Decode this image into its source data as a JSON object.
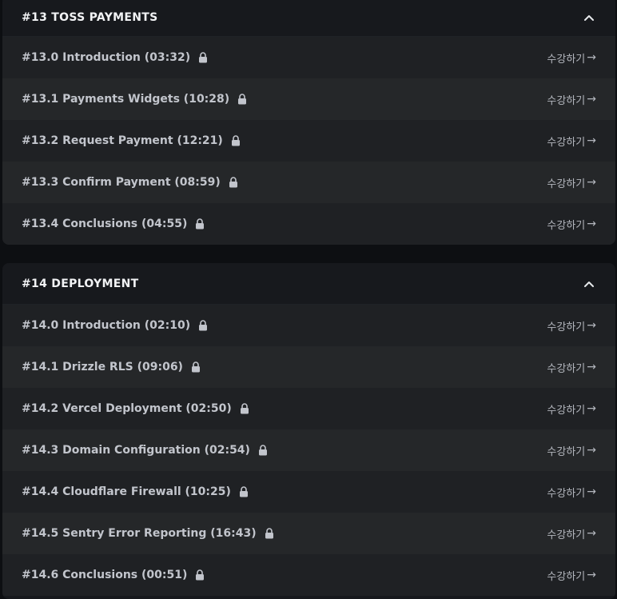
{
  "sections": [
    {
      "title": "#13 TOSS PAYMENTS",
      "lessons": [
        {
          "title": "#13.0 Introduction (03:32)",
          "cta": "수강하기"
        },
        {
          "title": "#13.1 Payments Widgets (10:28)",
          "cta": "수강하기"
        },
        {
          "title": "#13.2 Request Payment (12:21)",
          "cta": "수강하기"
        },
        {
          "title": "#13.3 Confirm Payment (08:59)",
          "cta": "수강하기"
        },
        {
          "title": "#13.4 Conclusions (04:55)",
          "cta": "수강하기"
        }
      ]
    },
    {
      "title": "#14 DEPLOYMENT",
      "lessons": [
        {
          "title": "#14.0 Introduction (02:10)",
          "cta": "수강하기"
        },
        {
          "title": "#14.1 Drizzle RLS (09:06)",
          "cta": "수강하기"
        },
        {
          "title": "#14.2 Vercel Deployment (02:50)",
          "cta": "수강하기"
        },
        {
          "title": "#14.3 Domain Configuration (02:54)",
          "cta": "수강하기"
        },
        {
          "title": "#14.4 Cloudflare Firewall (10:25)",
          "cta": "수강하기"
        },
        {
          "title": "#14.5 Sentry Error Reporting (16:43)",
          "cta": "수강하기"
        },
        {
          "title": "#14.6 Conclusions (00:51)",
          "cta": "수강하기"
        }
      ]
    }
  ],
  "icons": {
    "lock": "lock-icon",
    "collapse": "chevron-up-icon",
    "arrow": "arrow-right-icon"
  },
  "arrow_glyph": "→",
  "colors": {
    "background": "#0d0f12",
    "panel": "#17191d",
    "row_a": "#1f2124",
    "row_b": "#252729",
    "text": "#c2c5cc",
    "title": "#f2f3f5"
  }
}
